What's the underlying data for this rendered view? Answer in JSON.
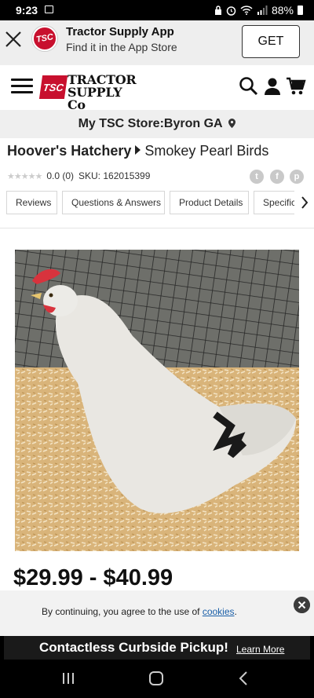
{
  "status_bar": {
    "time": "9:23",
    "battery": "88%"
  },
  "app_banner": {
    "title": "Tractor Supply App",
    "subtitle": "Find it in the App Store",
    "get_label": "GET",
    "logo_text": "TSC"
  },
  "header": {
    "logo_badge": "TSC",
    "logo_line1": "TRACTOR",
    "logo_line2": "SUPPLY Co"
  },
  "store": {
    "label": "My TSC Store:Byron GA"
  },
  "product": {
    "brand": "Hoover's Hatchery",
    "name": "Smokey Pearl Birds",
    "rating_text": "0.0 (0)",
    "sku": "SKU: 162015399",
    "price": "$29.99 - $40.99"
  },
  "tabs": [
    {
      "label": "Reviews"
    },
    {
      "label": "Questions & Answers"
    },
    {
      "label": "Product Details"
    },
    {
      "label": "Specifications"
    }
  ],
  "cookie": {
    "message": "By continuing, you agree to the use of",
    "link": "cookies",
    "suffix": "."
  },
  "curbside": {
    "text": "Contactless Curbside Pickup!",
    "link": "Learn More"
  },
  "colors": {
    "brand_red": "#c8102e",
    "link_blue": "#1a5fa8"
  }
}
